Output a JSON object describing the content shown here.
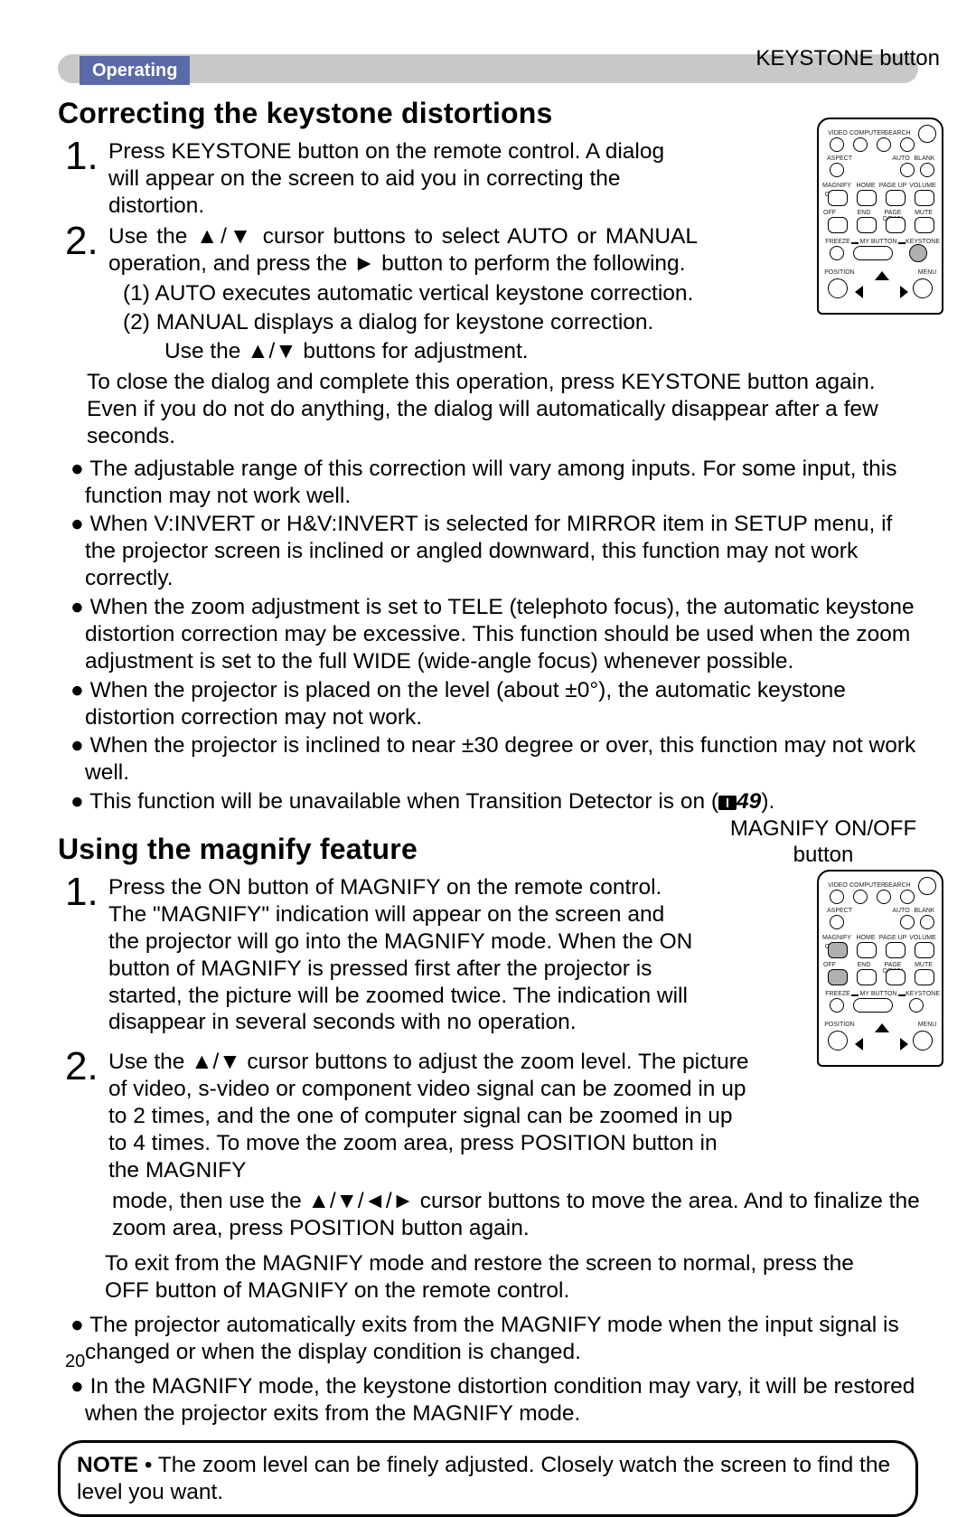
{
  "section_tab": "Operating",
  "keystone_label": "KEYSTONE button",
  "magnify_label": "MAGNIFY ON/OFF button",
  "page_number": "20",
  "section1": {
    "heading": "Correcting the keystone distortions",
    "step1_num": "1.",
    "step1": "Press KEYSTONE button on the remote control. A dialog will appear on the screen to aid you in correcting the distortion.",
    "step2_num": "2.",
    "step2": "Use the ▲/▼ cursor buttons to select AUTO or MANUAL operation, and press the ► button to perform the following.",
    "sub1": "(1)  AUTO executes automatic vertical keystone correction.",
    "sub2a": "(2)  MANUAL displays a dialog for keystone correction.",
    "sub2b": "Use the ▲/▼ buttons for adjustment.",
    "after": "To close the dialog and complete this operation, press KEYSTONE button again. Even if you do not do anything, the dialog will automatically disappear after a few seconds.",
    "bul1": "● The adjustable range of this correction will vary among inputs. For some input, this function may not work well.",
    "bul2": "● When V:INVERT or H&V:INVERT is selected for MIRROR item in SETUP menu, if the projector screen is inclined or angled downward, this function may not work correctly.",
    "bul3": "● When the zoom adjustment is set to TELE (telephoto focus), the automatic keystone distortion correction may be excessive. This function should be used when the zoom adjustment is set to the full WIDE (wide-angle focus) whenever possible.",
    "bul4": "● When the projector is placed on the level (about ±0°), the automatic keystone distortion correction may not work.",
    "bul5": "● When the projector is inclined to near ±30 degree or over, this function may not work well.",
    "bul6_pre": "● This function will be unavailable when Transition Detector is on (",
    "bul6_ref": "49",
    "bul6_post": ")."
  },
  "section2": {
    "heading": "Using the magnify feature",
    "step1_num": "1.",
    "step1": "Press the ON button of MAGNIFY on the remote control. The \"MAGNIFY\" indication will appear on the screen and the projector will go into the MAGNIFY mode. When the ON button of MAGNIFY is pressed first after the projector is started, the picture will be zoomed twice. The indication will disappear in several seconds with no operation.",
    "step2_num": "2.",
    "step2a": "Use the ▲/▼ cursor buttons to adjust the zoom level. The picture of video, s-video or component video signal can be zoomed in up to 2 times, and the one of computer signal can be zoomed in up to 4 times. To move the zoom area, press POSITION button in the MAGNIFY",
    "step2b": "mode, then use the ▲/▼/◄/► cursor buttons to move the area. And to finalize the zoom area, press POSITION button again.",
    "after": "To exit from the MAGNIFY mode and restore the screen to normal, press the OFF button of MAGNIFY on the remote control.",
    "bul1": "● The projector automatically exits from the MAGNIFY mode when the input signal is changed or when the display condition is changed.",
    "bul2": "● In the MAGNIFY mode, the keystone distortion condition may vary, it will be restored when the projector exits from the MAGNIFY mode."
  },
  "note": {
    "label": "NOTE",
    "text": "  • The zoom level can be finely adjusted. Closely watch the screen to find the level you want."
  },
  "remote_labels": {
    "video": "VIDEO",
    "computer": "COMPUTER",
    "search": "SEARCH",
    "aspect": "ASPECT",
    "auto": "AUTO",
    "blank": "BLANK",
    "magnify": "MAGNIFY",
    "home": "HOME",
    "pageup": "PAGE UP",
    "volume": "VOLUME",
    "on": "ON",
    "off": "OFF",
    "end": "END",
    "pagedn": "PAGE DOWN",
    "mute": "MUTE",
    "freeze": "FREEZE",
    "mybutton": "MY BUTTON",
    "keystone": "KEYSTONE",
    "position": "POSITION",
    "menu": "MENU"
  }
}
